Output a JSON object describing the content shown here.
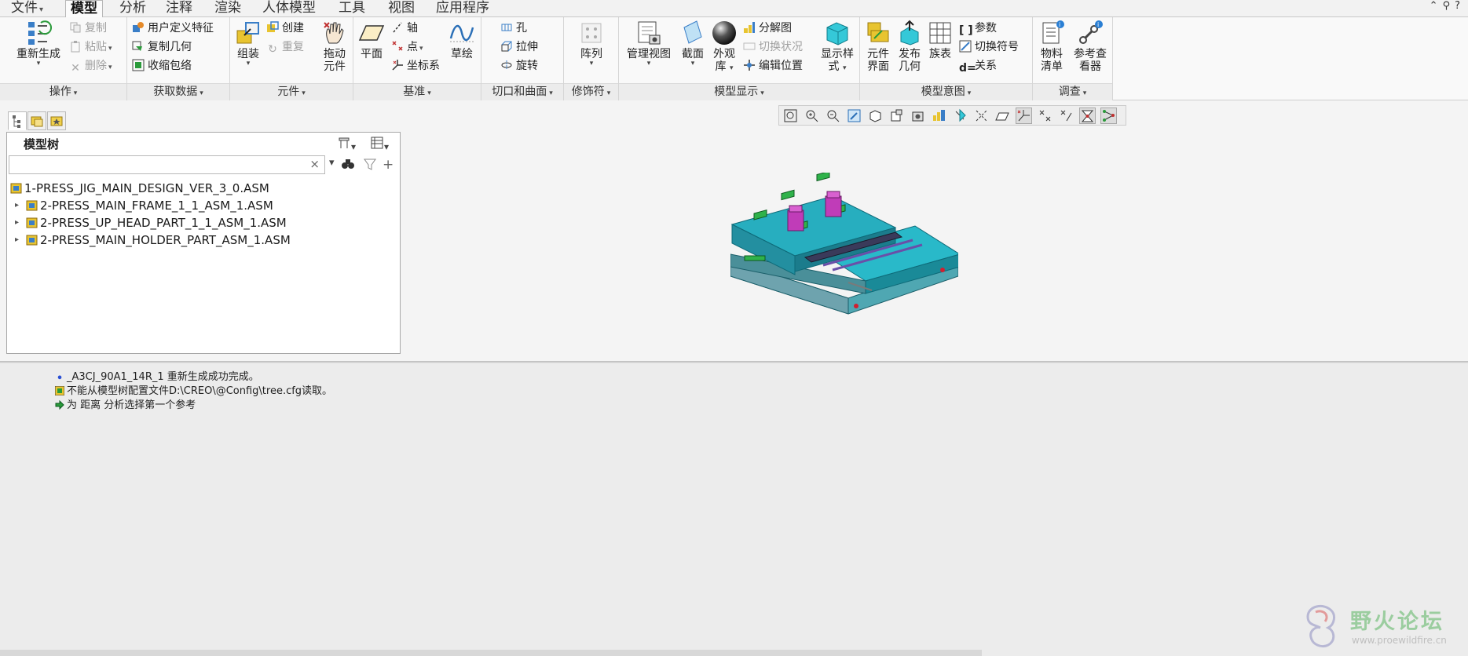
{
  "menu": {
    "file": "文件",
    "tabs": [
      "模型",
      "分析",
      "注释",
      "渲染",
      "人体模型",
      "工具",
      "视图",
      "应用程序"
    ],
    "active_tab": "模型"
  },
  "ribbon": {
    "groups": {
      "operations": "操作",
      "get_data": "获取数据",
      "component": "元件",
      "datum": "基准",
      "cut_surface": "切口和曲面",
      "modifiers": "修饰符",
      "model_display": "模型显示",
      "model_intent": "模型意图",
      "investigate": "调查"
    },
    "operations": {
      "regenerate": "重新生成",
      "copy": "复制",
      "paste": "粘贴",
      "delete": "删除"
    },
    "get_data": {
      "udf": "用户定义特征",
      "copy_geom": "复制几何",
      "shrinkwrap": "收缩包络"
    },
    "component": {
      "assemble": "组装",
      "create": "创建",
      "repeat": "重复",
      "drag_1": "拖动",
      "drag_2": "元件"
    },
    "datum": {
      "plane": "平面",
      "axis": "轴",
      "point": "点",
      "csys": "坐标系",
      "sketch": "草绘"
    },
    "cut_surface": {
      "hole": "孔",
      "extrude": "拉伸",
      "revolve": "旋转"
    },
    "modifiers": {
      "pattern": "阵列"
    },
    "model_display": {
      "manage_views": "管理视图",
      "section": "截面",
      "appearance_1": "外观",
      "appearance_2": "库",
      "exploded": "分解图",
      "toggle_status": "切换状况",
      "edit_position": "编辑位置",
      "display_style_1": "显示样",
      "display_style_2": "式"
    },
    "model_intent": {
      "comp_iface_1": "元件",
      "comp_iface_2": "界面",
      "publish_1": "发布",
      "publish_2": "几何",
      "family_table": "族表",
      "parameters": "参数",
      "switch_symbols": "切换符号",
      "relations": "关系"
    },
    "investigate": {
      "bom_1": "物料",
      "bom_2": "清单",
      "ref_1": "参考查",
      "ref_2": "看器"
    }
  },
  "model_tree": {
    "title": "模型树",
    "search_value": "",
    "items": [
      {
        "label": "1-PRESS_JIG_MAIN_DESIGN_VER_3_0.ASM",
        "level": 0,
        "expandable": false
      },
      {
        "label": "2-PRESS_MAIN_FRAME_1_1_ASM_1.ASM",
        "level": 1,
        "expandable": true
      },
      {
        "label": "2-PRESS_UP_HEAD_PART_1_1_ASM_1.ASM",
        "level": 1,
        "expandable": true
      },
      {
        "label": "2-PRESS_MAIN_HOLDER_PART_ASM_1.ASM",
        "level": 1,
        "expandable": true
      }
    ]
  },
  "messages": [
    {
      "icon": "info-bullet-icon",
      "text": "_A3CJ_90A1_14R_1 重新生成成功完成。"
    },
    {
      "icon": "warning-icon",
      "text": "不能从模型树配置文件D:\\CREO\\@Config\\tree.cfg读取。"
    },
    {
      "icon": "prompt-arrow-icon",
      "text": "为 距离 分析选择第一个参考"
    }
  ],
  "watermark": {
    "title": "野火论坛",
    "url": "www.proewildfire.cn"
  },
  "colors": {
    "model_cyan": "#1ea6b7",
    "model_magenta": "#c03cb8",
    "model_green": "#2fb24a",
    "accent_blue": "#2a7fd4"
  }
}
